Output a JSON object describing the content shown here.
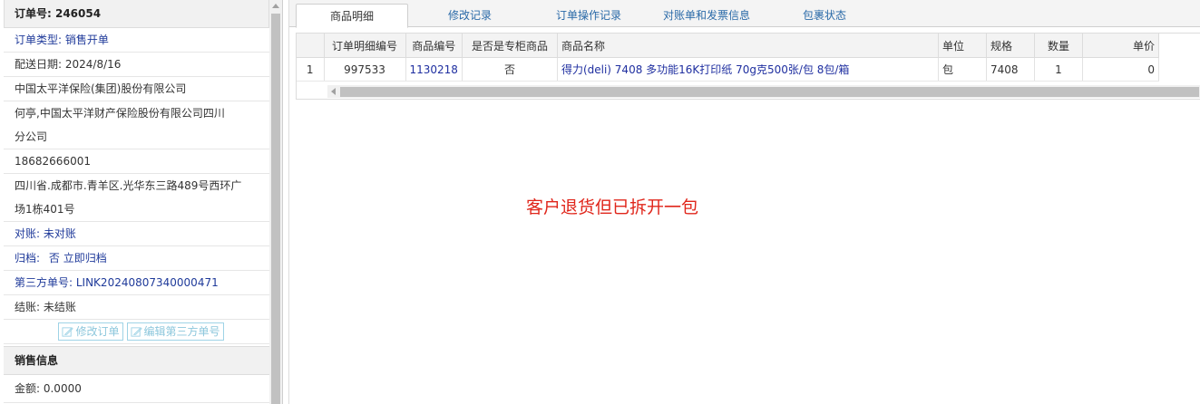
{
  "order": {
    "title": "订单号: 246054",
    "type_label": "订单类型:",
    "type_value": "销售开单",
    "delivery_date": "配送日期: 2024/8/16",
    "company": "中国太平洋保险(集团)股份有限公司",
    "contact_line1": "何亭,中国太平洋财产保险股份有限公司四川",
    "contact_line2": "分公司",
    "phone": "18682666001",
    "address_line1": "四川省.成都市.青羊区.光华东三路489号西环广",
    "address_line2": "场1栋401号",
    "reconcile": "对账: 未对账",
    "archive_label": "归档:",
    "archive_value": "否 立即归档",
    "third_party": "第三方单号: LINK20240807340000471",
    "settle": "结账: 未结账",
    "btn_edit_order": "修改订单",
    "btn_edit_third": "编辑第三方单号"
  },
  "sales": {
    "title": "销售信息",
    "amount": "金额: 0.0000"
  },
  "tabs": [
    "商品明细",
    "修改记录",
    "订单操作记录",
    "对账单和发票信息",
    "包裹状态"
  ],
  "grid": {
    "columns": [
      "",
      "订单明细编号",
      "商品编号",
      "是否是专柜商品",
      "商品名称",
      "单位",
      "规格",
      "数量",
      "单价"
    ],
    "rows": [
      [
        "1",
        "997533",
        "1130218",
        "否",
        "得力(deli) 7408 多功能16K打印纸 70g克500张/包 8包/箱",
        "包",
        "7408",
        "1",
        "0"
      ]
    ]
  },
  "note": "客户退货但已拆开一包",
  "colors": {
    "link": "#1f2fa0",
    "note": "#e0261b",
    "tab_text": "#2a6aa8"
  }
}
